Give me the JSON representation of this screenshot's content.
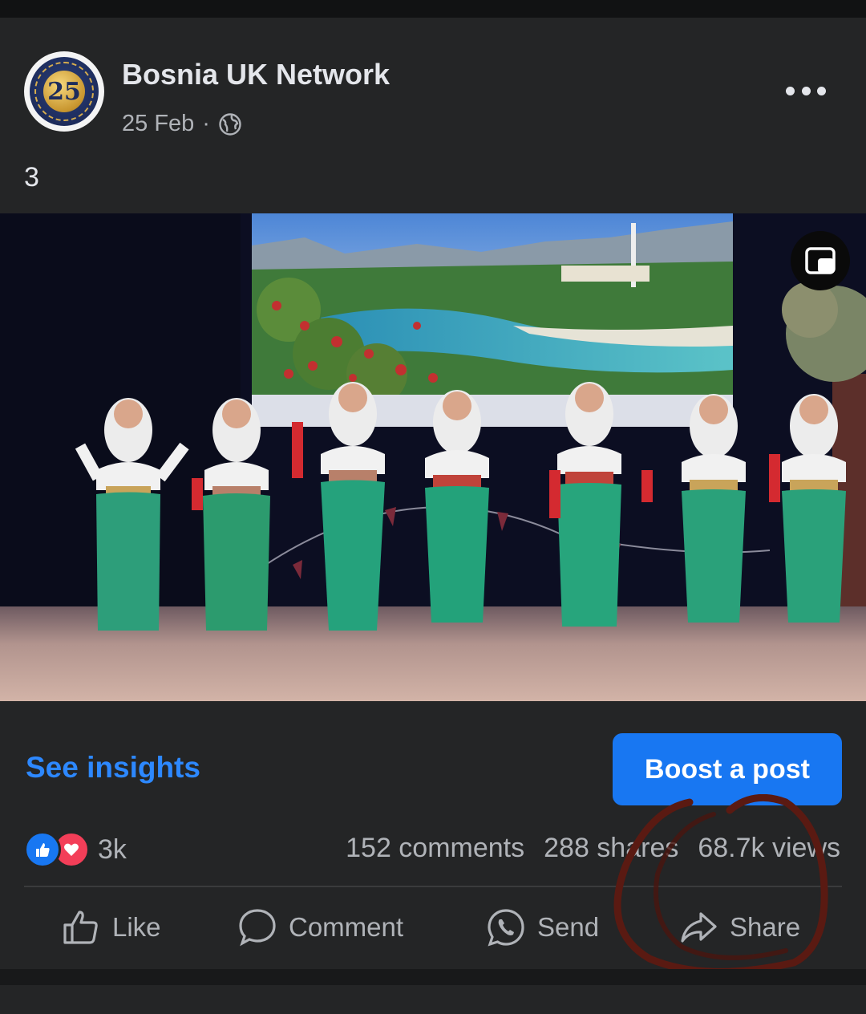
{
  "post": {
    "author": "Bosnia UK Network",
    "date": "25 Feb",
    "separator": "·",
    "text": "3",
    "avatar": {
      "badge_text": "25"
    }
  },
  "video": {
    "description_icon": "picture-in-picture-icon"
  },
  "insights": {
    "label": "See insights"
  },
  "boost": {
    "label": "Boost a post"
  },
  "reactions": {
    "count": "3k",
    "types": [
      "like",
      "love"
    ]
  },
  "stats": {
    "comments": "152 comments",
    "shares": "288 shares",
    "views": "68.7k views"
  },
  "actions": [
    {
      "label": "Like",
      "icon": "thumbs-up-icon"
    },
    {
      "label": "Comment",
      "icon": "speech-bubble-icon"
    },
    {
      "label": "Send",
      "icon": "whatsapp-icon"
    },
    {
      "label": "Share",
      "icon": "share-arrow-icon"
    }
  ],
  "colors": {
    "background": "#242526",
    "accent": "#1877f2",
    "link": "#2d88ff",
    "secondary_text": "#b0b3b8",
    "love": "#f33e58",
    "annotation": "#5a1a12"
  }
}
